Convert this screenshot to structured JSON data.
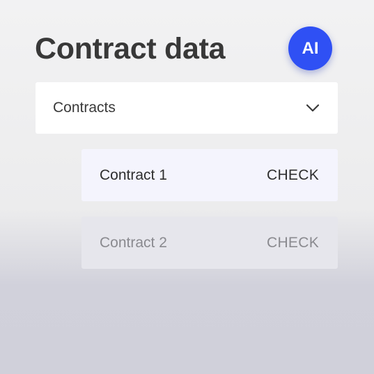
{
  "header": {
    "title": "Contract data",
    "ai_badge_label": "AI"
  },
  "dropdown": {
    "label": "Contracts",
    "icon": "chevron-down-icon"
  },
  "contracts": [
    {
      "name": "Contract 1",
      "action_label": "CHECK"
    },
    {
      "name": "Contract 2",
      "action_label": "CHECK"
    }
  ],
  "colors": {
    "accent": "#2f50f4",
    "title_text": "#383838",
    "row_active_bg": "#f4f4fd"
  }
}
